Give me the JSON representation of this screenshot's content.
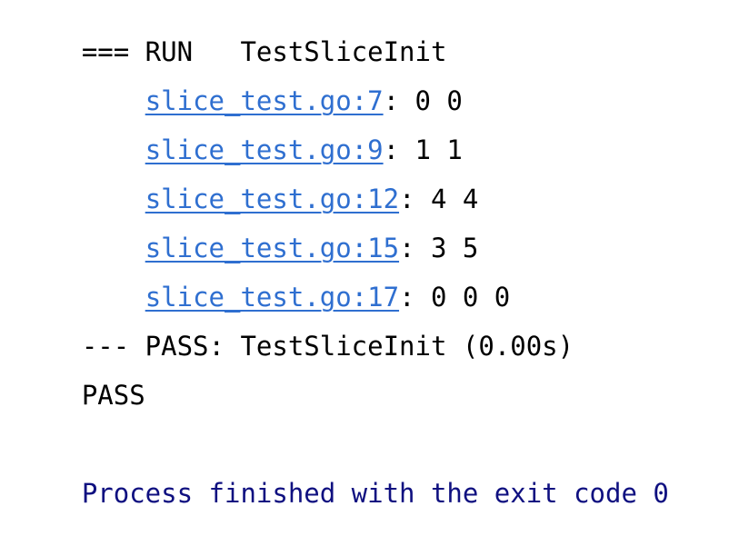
{
  "console": {
    "background_color": "#ffffff",
    "text_color": "#000000",
    "link_color": "#2f6fd0",
    "exit_line_color": "#0f1080",
    "lines": [
      {
        "kind": "run-header",
        "text": "=== RUN   TestSliceInit"
      },
      {
        "kind": "log-line",
        "indent": "    ",
        "link": "slice_test.go:7",
        "rest": ": 0 0"
      },
      {
        "kind": "log-line",
        "indent": "    ",
        "link": "slice_test.go:9",
        "rest": ": 1 1"
      },
      {
        "kind": "log-line",
        "indent": "    ",
        "link": "slice_test.go:12",
        "rest": ": 4 4"
      },
      {
        "kind": "log-line",
        "indent": "    ",
        "link": "slice_test.go:15",
        "rest": ": 3 5"
      },
      {
        "kind": "log-line",
        "indent": "    ",
        "link": "slice_test.go:17",
        "rest": ": 0 0 0"
      },
      {
        "kind": "result-line",
        "text": "--- PASS: TestSliceInit (0.00s)"
      },
      {
        "kind": "summary-line",
        "text": "PASS"
      },
      {
        "kind": "blank",
        "text": ""
      },
      {
        "kind": "exit-line",
        "text": "Process finished with the exit code 0"
      }
    ]
  }
}
